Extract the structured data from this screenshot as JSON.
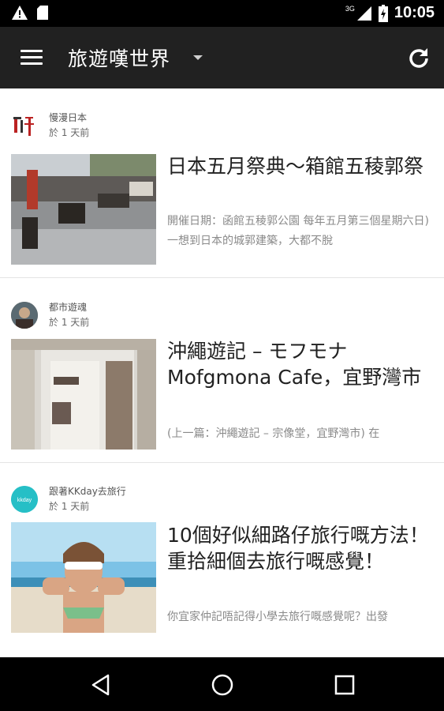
{
  "status_bar": {
    "time": "10:05",
    "network": "3G",
    "icons": [
      "warning-icon",
      "sd-card-icon",
      "signal-icon",
      "battery-icon"
    ]
  },
  "app_bar": {
    "title": "旅遊嘆世界",
    "icons": [
      "menu-icon",
      "dropdown-arrow-icon",
      "refresh-icon"
    ]
  },
  "feed": {
    "items": [
      {
        "source": "慢漫日本",
        "time": "於 1 天前",
        "title": "日本五月祭典～箱館五稜郭祭",
        "excerpt": "開催日期：函館五稜郭公園 每年五月第三個星期六日) 一想到日本的城郭建築，大都不脫"
      },
      {
        "source": "都市遊魂",
        "time": "於 1 天前",
        "title": "沖繩遊記 – モフモナ Mofgmona Cafe，宜野灣市",
        "excerpt": "(上一篇：沖繩遊記 – 宗像堂，宜野灣市) 在"
      },
      {
        "source": "跟著KKday去旅行",
        "time": "於 1 天前",
        "title": "10個好似細路仔旅行嘅方法！重拾細個去旅行嘅感覺！",
        "excerpt": "你宜家仲記唔記得小學去旅行嘅感覺呢？出發",
        "avatar_text": "kkday"
      }
    ]
  },
  "nav_bar": {
    "icons": [
      "back-icon",
      "home-icon",
      "recents-icon"
    ]
  },
  "colors": {
    "app_bar": "#212121",
    "status_bar": "#000000",
    "kkday_teal": "#26bfc6"
  }
}
